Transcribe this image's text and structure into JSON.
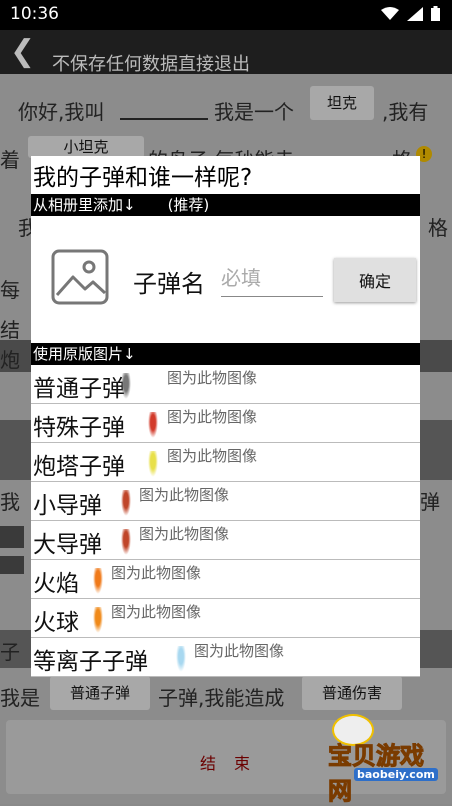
{
  "status": {
    "time": "10:36"
  },
  "toolbar": {
    "title": "不保存任何数据直接退出"
  },
  "background": {
    "line1_a": "你好,我叫",
    "line1_b": "我是一个",
    "line1_chip": "坦克",
    "line1_c": ",我有",
    "line2_a": "着",
    "line2_chip": "小坦克",
    "line2_b": "的鸟子 每秒能走",
    "line2_c": "格",
    "line3_a": "我",
    "line3_c": "格",
    "line4_a": "每",
    "line5_a": "结",
    "line6_a": "炮",
    "line7_a": "我",
    "line7_c": "弹",
    "line8_a": "子",
    "footer_a": "我是",
    "footer_chip1": "普通子弹",
    "footer_b": "子弹,我能造成",
    "footer_chip2": "普通伤害",
    "end_label": "结束"
  },
  "watermark": {
    "text": "宝贝游戏网",
    "url": "baobeiy.com"
  },
  "dialog": {
    "title": "我的子弹和谁一样呢?",
    "add_from_album": "从相册里添加↓",
    "recommended": "(推荐)",
    "bullet_name_label": "子弹名",
    "bullet_name_placeholder": "必填",
    "confirm_button": "确定",
    "use_original": "使用原版图片↓",
    "items": [
      {
        "name": "普通子弹",
        "hint": "图为此物图像",
        "color": "#777777"
      },
      {
        "name": "特殊子弹",
        "hint": "图为此物图像",
        "color": "#d23a2a"
      },
      {
        "name": "炮塔子弹",
        "hint": "图为此物图像",
        "color": "#e8e04a"
      },
      {
        "name": "小导弹",
        "hint": "图为此物图像",
        "color": "#c0462a"
      },
      {
        "name": "大导弹",
        "hint": "图为此物图像",
        "color": "#c0462a"
      },
      {
        "name": "火焰",
        "hint": "图为此物图像",
        "color": "#f07a1a"
      },
      {
        "name": "火球",
        "hint": "图为此物图像",
        "color": "#f08a1a"
      },
      {
        "name": "等离子子弹",
        "hint": "图为此物图像",
        "color": "#a8d8f0"
      }
    ]
  }
}
